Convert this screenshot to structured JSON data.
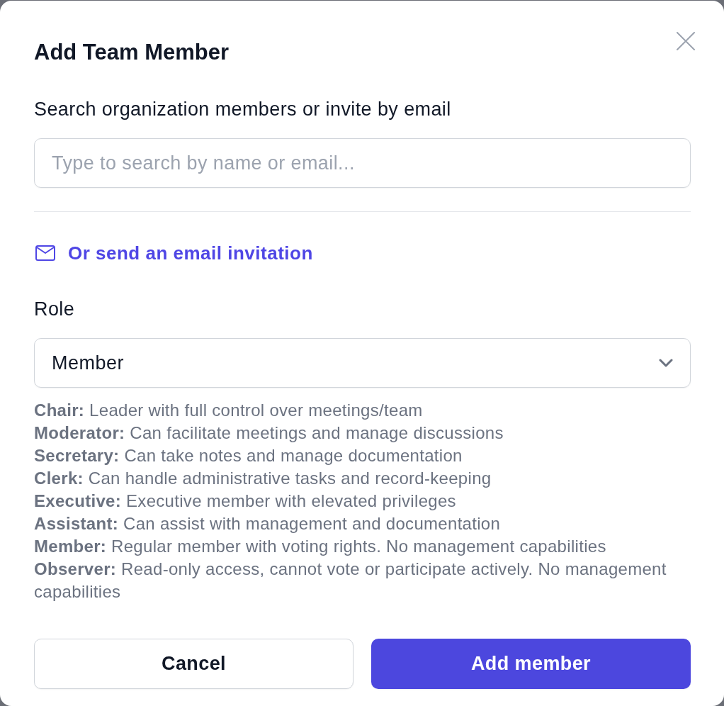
{
  "dialog": {
    "title": "Add Team Member"
  },
  "search": {
    "label": "Search organization members or invite by email",
    "placeholder": "Type to search by name or email..."
  },
  "email_invite_link": {
    "label": "Or send an email invitation"
  },
  "role": {
    "label": "Role",
    "value": "Member"
  },
  "role_descriptions": [
    "**Chair:** Leader with full control over meetings/team",
    "**Moderator:** Can facilitate meetings and manage discussions",
    "**Secretary:** Can take notes and manage documentation",
    "**Clerk:** Can handle administrative tasks and record-keeping",
    "**Executive:** Executive member with elevated privileges",
    "**Assistant:** Can assist with management and documentation",
    "**Member:** Regular member with voting rights. No management capabilities",
    "**Observer:** Read-only access, cannot vote or participate actively. No management capabilities"
  ],
  "buttons": [
    {
      "label": "Cancel",
      "kind": "secondary"
    },
    {
      "label": "Add member",
      "kind": "primary"
    }
  ]
}
